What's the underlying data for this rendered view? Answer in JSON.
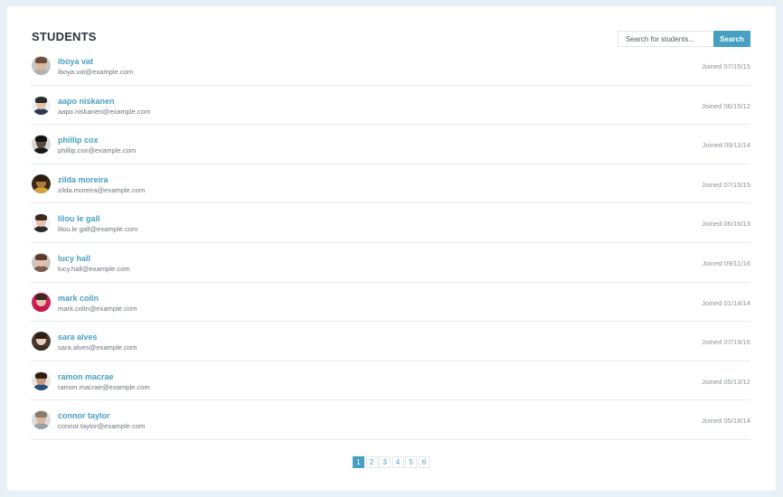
{
  "header": {
    "title": "STUDENTS"
  },
  "search": {
    "placeholder": "Search for students...",
    "button_label": "Search"
  },
  "colors": {
    "accent": "#479fc2",
    "background": "#e6f0f5"
  },
  "students": [
    {
      "name": "iboya vat",
      "email": "iboya.vat@example.com",
      "joined": "Joined 07/15/15",
      "avatar": {
        "skin": "#d9b6a0",
        "hair": "#6b4b3a",
        "shirt": "#b8b0aa",
        "bg": "#c9c6c3"
      }
    },
    {
      "name": "aapo niskanen",
      "email": "aapo.niskanen@example.com",
      "joined": "Joined 06/15/12",
      "avatar": {
        "skin": "#e5c2a8",
        "hair": "#2b2b2b",
        "shirt": "#2d3a55",
        "bg": "#eef0f2"
      }
    },
    {
      "name": "phillip cox",
      "email": "phillip.cox@example.com",
      "joined": "Joined 09/11/14",
      "avatar": {
        "skin": "#5b4a42",
        "hair": "#111111",
        "shirt": "#1a1a1a",
        "bg": "#d8d8d8"
      }
    },
    {
      "name": "zilda moreira",
      "email": "zilda.moreira@example.com",
      "joined": "Joined 07/15/15",
      "avatar": {
        "skin": "#b07a3c",
        "hair": "#2a1c10",
        "shirt": "#d4a43b",
        "bg": "#3a2b18"
      }
    },
    {
      "name": "lilou le gall",
      "email": "lilou.le gall@example.com",
      "joined": "Joined 06/16/13",
      "avatar": {
        "skin": "#e6c0a8",
        "hair": "#3b2a20",
        "shirt": "#2a2a2a",
        "bg": "#f2f2f2"
      }
    },
    {
      "name": "lucy hall",
      "email": "lucy.hall@example.com",
      "joined": "Joined 09/11/16",
      "avatar": {
        "skin": "#e4c1ad",
        "hair": "#5a3a2c",
        "shirt": "#7a5a4c",
        "bg": "#cfc4bd"
      }
    },
    {
      "name": "mark colin",
      "email": "mark.colin@example.com",
      "joined": "Joined 01/14/14",
      "avatar": {
        "skin": "#e7c3ae",
        "hair": "#3a2a22",
        "shirt": "#c2184d",
        "bg": "#d11f55"
      }
    },
    {
      "name": "sara alves",
      "email": "sara.alves@example.com",
      "joined": "Joined 07/19/16",
      "avatar": {
        "skin": "#e9cdb9",
        "hair": "#2a1e18",
        "shirt": "#3a2e28",
        "bg": "#4a3a30"
      }
    },
    {
      "name": "ramon macrae",
      "email": "ramon.macrae@example.com",
      "joined": "Joined 05/13/12",
      "avatar": {
        "skin": "#c99878",
        "hair": "#2b1f18",
        "shirt": "#2e4f7a",
        "bg": "#e9e4e0"
      }
    },
    {
      "name": "connor taylor",
      "email": "connor.taylor@example.com",
      "joined": "Joined 05/18/14",
      "avatar": {
        "skin": "#d9b8a0",
        "hair": "#8a7a6a",
        "shirt": "#9aa0a4",
        "bg": "#dcdcdc"
      }
    }
  ],
  "pagination": {
    "pages": [
      "1",
      "2",
      "3",
      "4",
      "5",
      "6"
    ],
    "current": "1"
  }
}
